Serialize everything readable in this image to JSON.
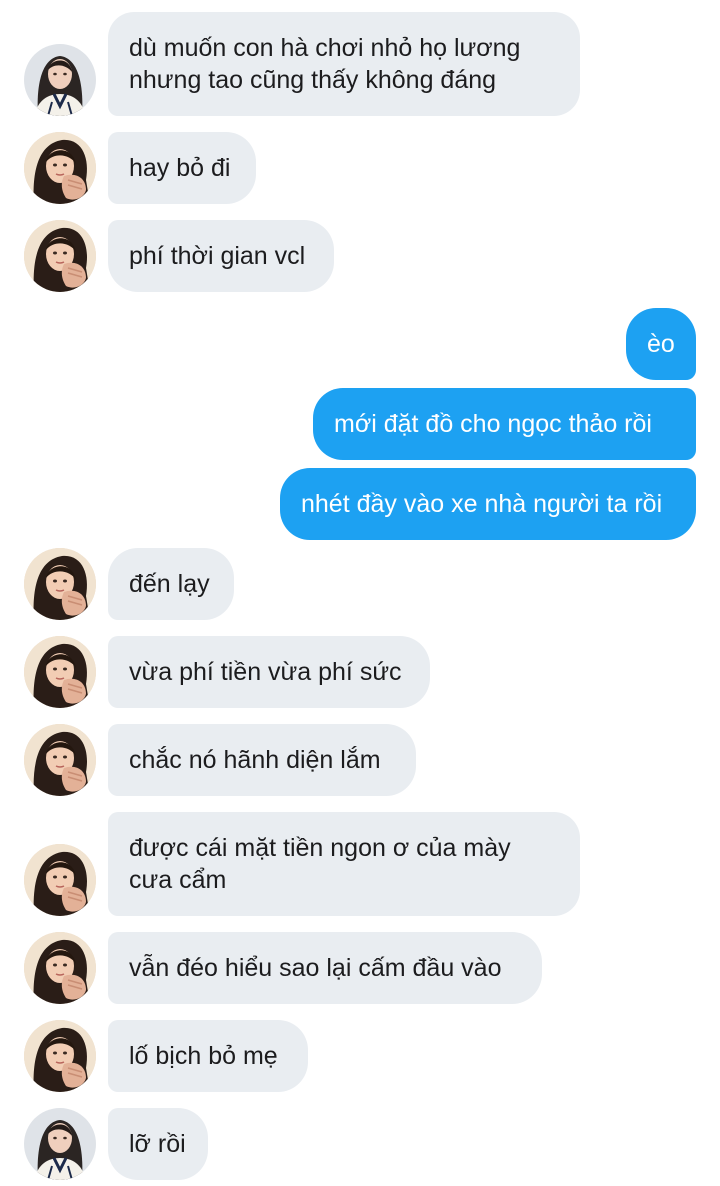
{
  "colors": {
    "incoming_bubble": "#e9edf1",
    "outgoing_bubble": "#1da1f2",
    "incoming_text": "#1c1c1e",
    "outgoing_text": "#ffffff"
  },
  "messages": [
    {
      "direction": "in",
      "avatar": "profile-photo-b",
      "text": "dù muốn con hà chơi nhỏ họ lương\nnhưng tao cũng thấy không đáng"
    },
    {
      "direction": "in",
      "avatar": "profile-photo-a",
      "text": "hay bỏ đi"
    },
    {
      "direction": "in",
      "avatar": "profile-photo-a",
      "text": "phí thời gian vcl"
    },
    {
      "direction": "out",
      "text": "èo"
    },
    {
      "direction": "out",
      "text": "mới đặt đồ cho ngọc thảo rồi"
    },
    {
      "direction": "out",
      "text": "nhét đầy vào xe nhà người ta rồi"
    },
    {
      "direction": "in",
      "avatar": "profile-photo-a",
      "text": "đến lạy"
    },
    {
      "direction": "in",
      "avatar": "profile-photo-a",
      "text": "vừa phí tiền vừa phí sức"
    },
    {
      "direction": "in",
      "avatar": "profile-photo-a",
      "text": "chắc nó hãnh diện lắm"
    },
    {
      "direction": "in",
      "avatar": "profile-photo-a",
      "text": "được cái mặt tiền ngon ơ của mày\ncưa cẩm"
    },
    {
      "direction": "in",
      "avatar": "profile-photo-a",
      "text": "vẫn đéo hiểu sao lại cấm đầu vào"
    },
    {
      "direction": "in",
      "avatar": "profile-photo-a",
      "text": "lố bịch bỏ mẹ"
    },
    {
      "direction": "in",
      "avatar": "profile-photo-b",
      "text": "lỡ rồi"
    }
  ]
}
